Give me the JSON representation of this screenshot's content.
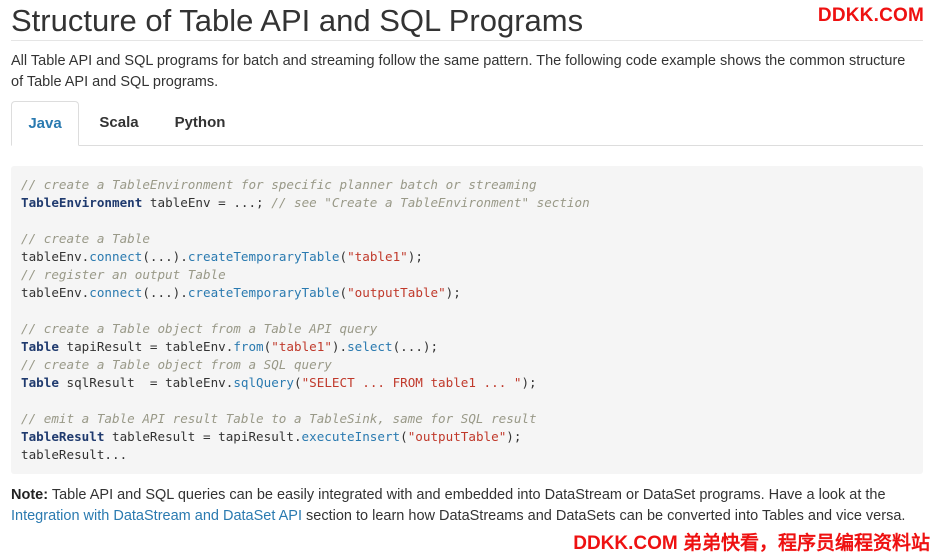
{
  "page": {
    "title": "Structure of Table API and SQL Programs",
    "intro": "All Table API and SQL programs for batch and streaming follow the same pattern. The following code example shows the common structure of Table API and SQL programs."
  },
  "watermark": {
    "top": "DDKK.COM",
    "bottom": "DDKK.COM 弟弟快看，程序员编程资料站"
  },
  "tabs": [
    {
      "label": "Java",
      "active": true
    },
    {
      "label": "Scala",
      "active": false
    },
    {
      "label": "Python",
      "active": false
    }
  ],
  "code": {
    "lines": [
      [
        {
          "t": "c",
          "v": "// create a TableEnvironment for specific planner batch or streaming"
        }
      ],
      [
        {
          "t": "k",
          "v": "TableEnvironment"
        },
        {
          "t": "p",
          "v": " tableEnv = ...; "
        },
        {
          "t": "c",
          "v": "// see \"Create a TableEnvironment\" section"
        }
      ],
      [],
      [
        {
          "t": "c",
          "v": "// create a Table"
        }
      ],
      [
        {
          "t": "p",
          "v": "tableEnv."
        },
        {
          "t": "m",
          "v": "connect"
        },
        {
          "t": "p",
          "v": "(...)."
        },
        {
          "t": "m",
          "v": "createTemporaryTable"
        },
        {
          "t": "p",
          "v": "("
        },
        {
          "t": "s",
          "v": "\"table1\""
        },
        {
          "t": "p",
          "v": ");"
        }
      ],
      [
        {
          "t": "c",
          "v": "// register an output Table"
        }
      ],
      [
        {
          "t": "p",
          "v": "tableEnv."
        },
        {
          "t": "m",
          "v": "connect"
        },
        {
          "t": "p",
          "v": "(...)."
        },
        {
          "t": "m",
          "v": "createTemporaryTable"
        },
        {
          "t": "p",
          "v": "("
        },
        {
          "t": "s",
          "v": "\"outputTable\""
        },
        {
          "t": "p",
          "v": ");"
        }
      ],
      [],
      [
        {
          "t": "c",
          "v": "// create a Table object from a Table API query"
        }
      ],
      [
        {
          "t": "k",
          "v": "Table"
        },
        {
          "t": "p",
          "v": " tapiResult = tableEnv."
        },
        {
          "t": "m",
          "v": "from"
        },
        {
          "t": "p",
          "v": "("
        },
        {
          "t": "s",
          "v": "\"table1\""
        },
        {
          "t": "p",
          "v": ")."
        },
        {
          "t": "m",
          "v": "select"
        },
        {
          "t": "p",
          "v": "(...);"
        }
      ],
      [
        {
          "t": "c",
          "v": "// create a Table object from a SQL query"
        }
      ],
      [
        {
          "t": "k",
          "v": "Table"
        },
        {
          "t": "p",
          "v": " sqlResult  = tableEnv."
        },
        {
          "t": "m",
          "v": "sqlQuery"
        },
        {
          "t": "p",
          "v": "("
        },
        {
          "t": "s",
          "v": "\"SELECT ... FROM table1 ... \""
        },
        {
          "t": "p",
          "v": ");"
        }
      ],
      [],
      [
        {
          "t": "c",
          "v": "// emit a Table API result Table to a TableSink, same for SQL result"
        }
      ],
      [
        {
          "t": "k",
          "v": "TableResult"
        },
        {
          "t": "p",
          "v": " tableResult = tapiResult."
        },
        {
          "t": "m",
          "v": "executeInsert"
        },
        {
          "t": "p",
          "v": "("
        },
        {
          "t": "s",
          "v": "\"outputTable\""
        },
        {
          "t": "p",
          "v": ");"
        }
      ],
      [
        {
          "t": "p",
          "v": "tableResult..."
        }
      ]
    ]
  },
  "note": {
    "label": "Note:",
    "text_before": " Table API and SQL queries can be easily integrated with and embedded into DataStream or DataSet programs. Have a look at the ",
    "link": "Integration with DataStream and DataSet API",
    "text_after": " section to learn how DataStreams and DataSets can be converted into Tables and vice versa."
  },
  "colors": {
    "accent": "#2a7ab0",
    "watermark": "#ee1111",
    "code_background": "#f5f5f5"
  }
}
